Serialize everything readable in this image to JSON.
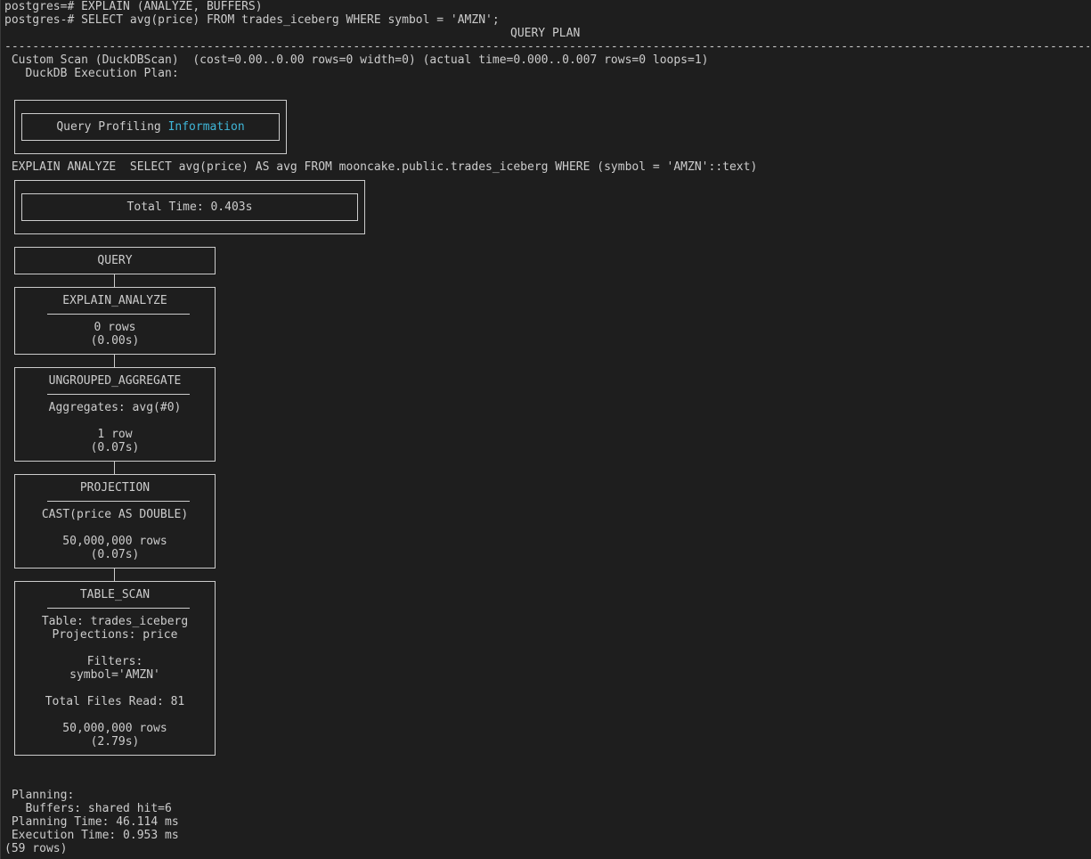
{
  "terminal": {
    "prompt_lines": [
      "postgres=# EXPLAIN (ANALYZE, BUFFERS)",
      "postgres-# SELECT avg(price) FROM trades_iceberg WHERE symbol = 'AMZN';"
    ],
    "column_header": "QUERY PLAN",
    "separator": "-------------------------------------------------------------------------------------------------------------------------------------------------------------",
    "custom_scan": " Custom Scan (DuckDBScan)  (cost=0.00..0.00 rows=0 width=0) (actual time=0.000..0.007 rows=0 loops=1)",
    "duckdb_plan": "   DuckDB Execution Plan:",
    "profiling": {
      "label": "Query Profiling",
      "highlight": "Information"
    },
    "explain_sql": " EXPLAIN ANALYZE  SELECT avg(price) AS avg FROM mooncake.public.trades_iceberg WHERE (symbol = 'AMZN'::text)",
    "total_time": "Total Time: 0.403s",
    "nodes": {
      "query": {
        "title": "QUERY"
      },
      "explain_analyze": {
        "title": "EXPLAIN_ANALYZE",
        "rows": "0 rows",
        "time": "(0.00s)"
      },
      "ungrouped_aggregate": {
        "title": "UNGROUPED_AGGREGATE",
        "detail": "Aggregates: avg(#0)",
        "rows": "1 row",
        "time": "(0.07s)"
      },
      "projection": {
        "title": "PROJECTION",
        "detail": "CAST(price AS DOUBLE)",
        "rows": "50,000,000 rows",
        "time": "(0.07s)"
      },
      "table_scan": {
        "title": "TABLE_SCAN",
        "table": "Table: trades_iceberg",
        "projections": "Projections: price",
        "filters_label": "Filters:",
        "filters_value": "symbol='AMZN'",
        "files_read": "Total Files Read: 81",
        "rows": "50,000,000 rows",
        "time": "(2.79s)"
      }
    },
    "footer": [
      " Planning:",
      "   Buffers: shared hit=6",
      " Planning Time: 46.114 ms",
      " Execution Time: 0.953 ms",
      "(59 rows)"
    ]
  }
}
